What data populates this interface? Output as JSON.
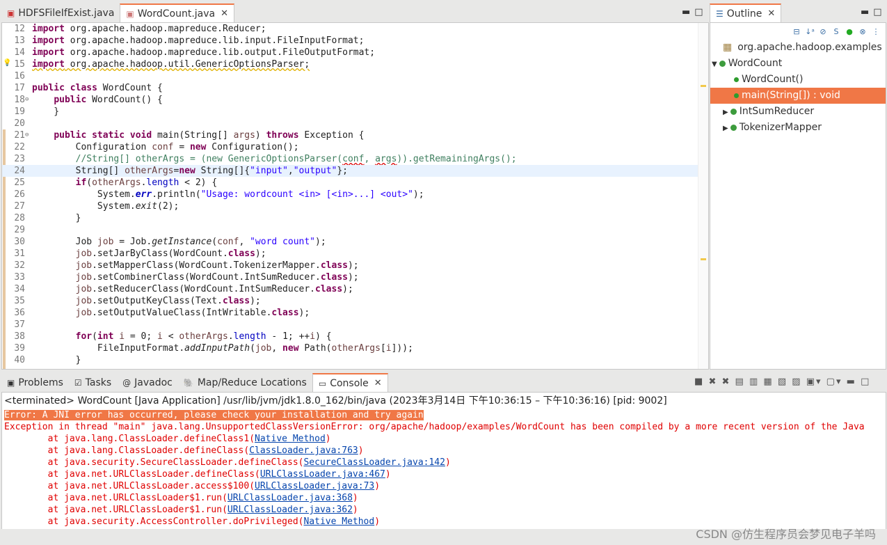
{
  "editor_tabs": [
    {
      "label": "HDFSFileIfExist.java",
      "active": false
    },
    {
      "label": "WordCount.java",
      "active": true
    }
  ],
  "code_lines": [
    {
      "n": "12",
      "html": "<span class='kw'>import</span> org.apache.hadoop.mapreduce.Reducer;"
    },
    {
      "n": "13",
      "html": "<span class='kw'>import</span> org.apache.hadoop.mapreduce.lib.input.FileInputFormat;"
    },
    {
      "n": "14",
      "html": "<span class='kw'>import</span> org.apache.hadoop.mapreduce.lib.output.FileOutputFormat;"
    },
    {
      "n": "15",
      "html": "<span class='kw warnline'>import</span><span class='warnline'> org.apache.hadoop.util.GenericOptionsParser;</span>"
    },
    {
      "n": "16",
      "html": ""
    },
    {
      "n": "17",
      "html": "<span class='kw'>public class</span> WordCount {"
    },
    {
      "n": "18",
      "fold": true,
      "html": "    <span class='kw'>public</span> WordCount() {"
    },
    {
      "n": "19",
      "html": "    }"
    },
    {
      "n": "20",
      "html": ""
    },
    {
      "n": "21",
      "fold": true,
      "html": "    <span class='kw'>public static void</span> main(String[] <span class='var'>args</span>) <span class='kw'>throws</span> Exception {"
    },
    {
      "n": "22",
      "html": "        Configuration <span class='var'>conf</span> = <span class='kw'>new</span> Configuration();"
    },
    {
      "n": "23",
      "html": "        <span class='cmt'>//String[] otherArgs = (new GenericOptionsParser(<span class='errline'>conf</span>, <span class='errline'>args</span>)).getRemainingArgs();</span>"
    },
    {
      "n": "24",
      "hl": true,
      "html": "        String[] <span class='var'>otherArgs</span>=<span class='kw'>new</span> String[]{<span class='str'>\"input\"</span>,<span class='str'>\"output\"</span>};"
    },
    {
      "n": "25",
      "html": "        <span class='kw'>if</span>(<span class='var'>otherArgs</span>.<span class='fld'>length</span> &lt; 2) {"
    },
    {
      "n": "26",
      "html": "            System.<span class='stfld'>err</span>.println(<span class='str'>\"Usage: wordcount &lt;in&gt; [&lt;in&gt;...] &lt;out&gt;\"</span>);"
    },
    {
      "n": "27",
      "html": "            System.<span class='stat'>exit</span>(2);"
    },
    {
      "n": "28",
      "html": "        }"
    },
    {
      "n": "29",
      "html": ""
    },
    {
      "n": "30",
      "html": "        Job <span class='var'>job</span> = Job.<span class='stat'>getInstance</span>(<span class='var'>conf</span>, <span class='str'>\"word count\"</span>);"
    },
    {
      "n": "31",
      "html": "        <span class='var'>job</span>.setJarByClass(WordCount.<span class='kw'>class</span>);"
    },
    {
      "n": "32",
      "html": "        <span class='var'>job</span>.setMapperClass(WordCount.TokenizerMapper.<span class='kw'>class</span>);"
    },
    {
      "n": "33",
      "html": "        <span class='var'>job</span>.setCombinerClass(WordCount.IntSumReducer.<span class='kw'>class</span>);"
    },
    {
      "n": "34",
      "html": "        <span class='var'>job</span>.setReducerClass(WordCount.IntSumReducer.<span class='kw'>class</span>);"
    },
    {
      "n": "35",
      "html": "        <span class='var'>job</span>.setOutputKeyClass(Text.<span class='kw'>class</span>);"
    },
    {
      "n": "36",
      "html": "        <span class='var'>job</span>.setOutputValueClass(IntWritable.<span class='kw'>class</span>);"
    },
    {
      "n": "37",
      "html": ""
    },
    {
      "n": "38",
      "html": "        <span class='kw'>for</span>(<span class='kw'>int</span> <span class='var'>i</span> = 0; <span class='var'>i</span> &lt; <span class='var'>otherArgs</span>.<span class='fld'>length</span> - 1; ++<span class='var'>i</span>) {"
    },
    {
      "n": "39",
      "html": "            FileInputFormat.<span class='stat'>addInputPath</span>(<span class='var'>job</span>, <span class='kw'>new</span> Path(<span class='var'>otherArgs</span>[<span class='var'>i</span>]));"
    },
    {
      "n": "40",
      "html": "        }"
    }
  ],
  "outline": {
    "tab_label": "Outline",
    "nodes": [
      {
        "label": "org.apache.hadoop.examples",
        "kind": "package"
      },
      {
        "label": "WordCount",
        "kind": "class"
      },
      {
        "label": "WordCount()",
        "kind": "constructor"
      },
      {
        "label": "main(String[]) : void",
        "kind": "method",
        "selected": true
      },
      {
        "label": "IntSumReducer",
        "kind": "inner-class"
      },
      {
        "label": "TokenizerMapper",
        "kind": "inner-class"
      }
    ]
  },
  "bottom_tabs": [
    {
      "label": "Problems",
      "icon": "problems-icon"
    },
    {
      "label": "Tasks",
      "icon": "tasks-icon"
    },
    {
      "label": "Javadoc",
      "icon": "javadoc-icon"
    },
    {
      "label": "Map/Reduce Locations",
      "icon": "mapreduce-icon"
    },
    {
      "label": "Console",
      "icon": "console-icon",
      "active": true
    }
  ],
  "console": {
    "status": "<terminated> WordCount [Java Application] /usr/lib/jvm/jdk1.8.0_162/bin/java  (2023年3月14日 下午10:36:15 – 下午10:36:16) [pid: 9002]",
    "error_line": "Error: A JNI error has occurred, please check your installation and try again",
    "exception_line": "Exception in thread \"main\" java.lang.UnsupportedClassVersionError: org/apache/hadoop/examples/WordCount has been compiled by a more recent version of the Java",
    "trace": [
      {
        "text": "        at java.lang.ClassLoader.defineClass1(",
        "link": "Native Method",
        "end": ")"
      },
      {
        "text": "        at java.lang.ClassLoader.defineClass(",
        "link": "ClassLoader.java:763",
        "end": ")"
      },
      {
        "text": "        at java.security.SecureClassLoader.defineClass(",
        "link": "SecureClassLoader.java:142",
        "end": ")"
      },
      {
        "text": "        at java.net.URLClassLoader.defineClass(",
        "link": "URLClassLoader.java:467",
        "end": ")"
      },
      {
        "text": "        at java.net.URLClassLoader.access$100(",
        "link": "URLClassLoader.java:73",
        "end": ")"
      },
      {
        "text": "        at java.net.URLClassLoader$1.run(",
        "link": "URLClassLoader.java:368",
        "end": ")"
      },
      {
        "text": "        at java.net.URLClassLoader$1.run(",
        "link": "URLClassLoader.java:362",
        "end": ")"
      },
      {
        "text": "        at java.security.AccessController.doPrivileged(",
        "link": "Native Method",
        "end": ")"
      }
    ]
  },
  "watermark": "CSDN @仿生程序员会梦见电子羊吗",
  "colors": {
    "accent": "#f07746",
    "keyword": "#7f0055",
    "string": "#2a00ff",
    "comment": "#3f7f5f",
    "error": "#e00000",
    "link": "#0645ad"
  }
}
